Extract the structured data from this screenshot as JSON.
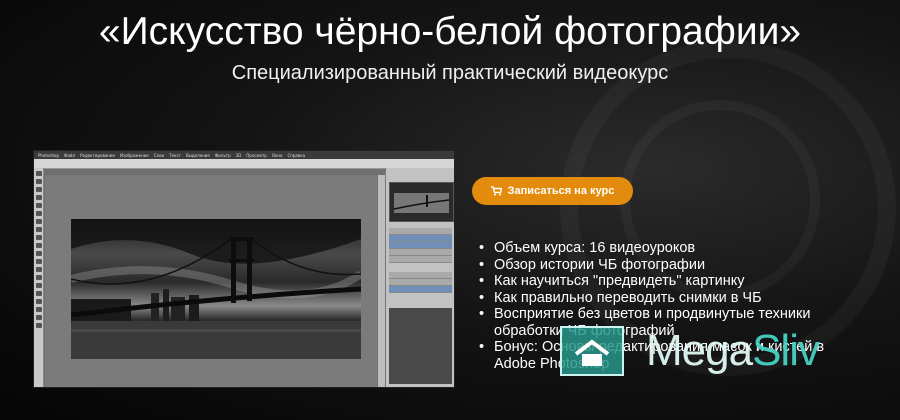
{
  "header": {
    "title": "«Искусство чёрно-белой фотографии»",
    "subtitle": "Специализированный практический видеокурс"
  },
  "screenshot": {
    "menu_items": [
      "Photoshop",
      "Файл",
      "Редактирование",
      "Изображение",
      "Слои",
      "Текст",
      "Выделение",
      "Фильтр",
      "3D",
      "Просмотр",
      "Окно",
      "Справка"
    ]
  },
  "cta": {
    "label": "Записаться на курс",
    "icon": "cart-icon",
    "color": "#e38b0d"
  },
  "features": [
    "Объем курса: 16 видеоуроков",
    "Обзор истории ЧБ фотографии",
    "Как научиться \"предвидеть\" картинку",
    "Как правильно переводить снимки в ЧБ",
    "Восприятие без цветов и продвинутые техники обработки ЧБ фотографий",
    "Бонус: Основы редактирования масок и кистей в Adobe Photoshop"
  ],
  "watermark": {
    "text_main": "Mega",
    "text_accent": "Sliv"
  }
}
